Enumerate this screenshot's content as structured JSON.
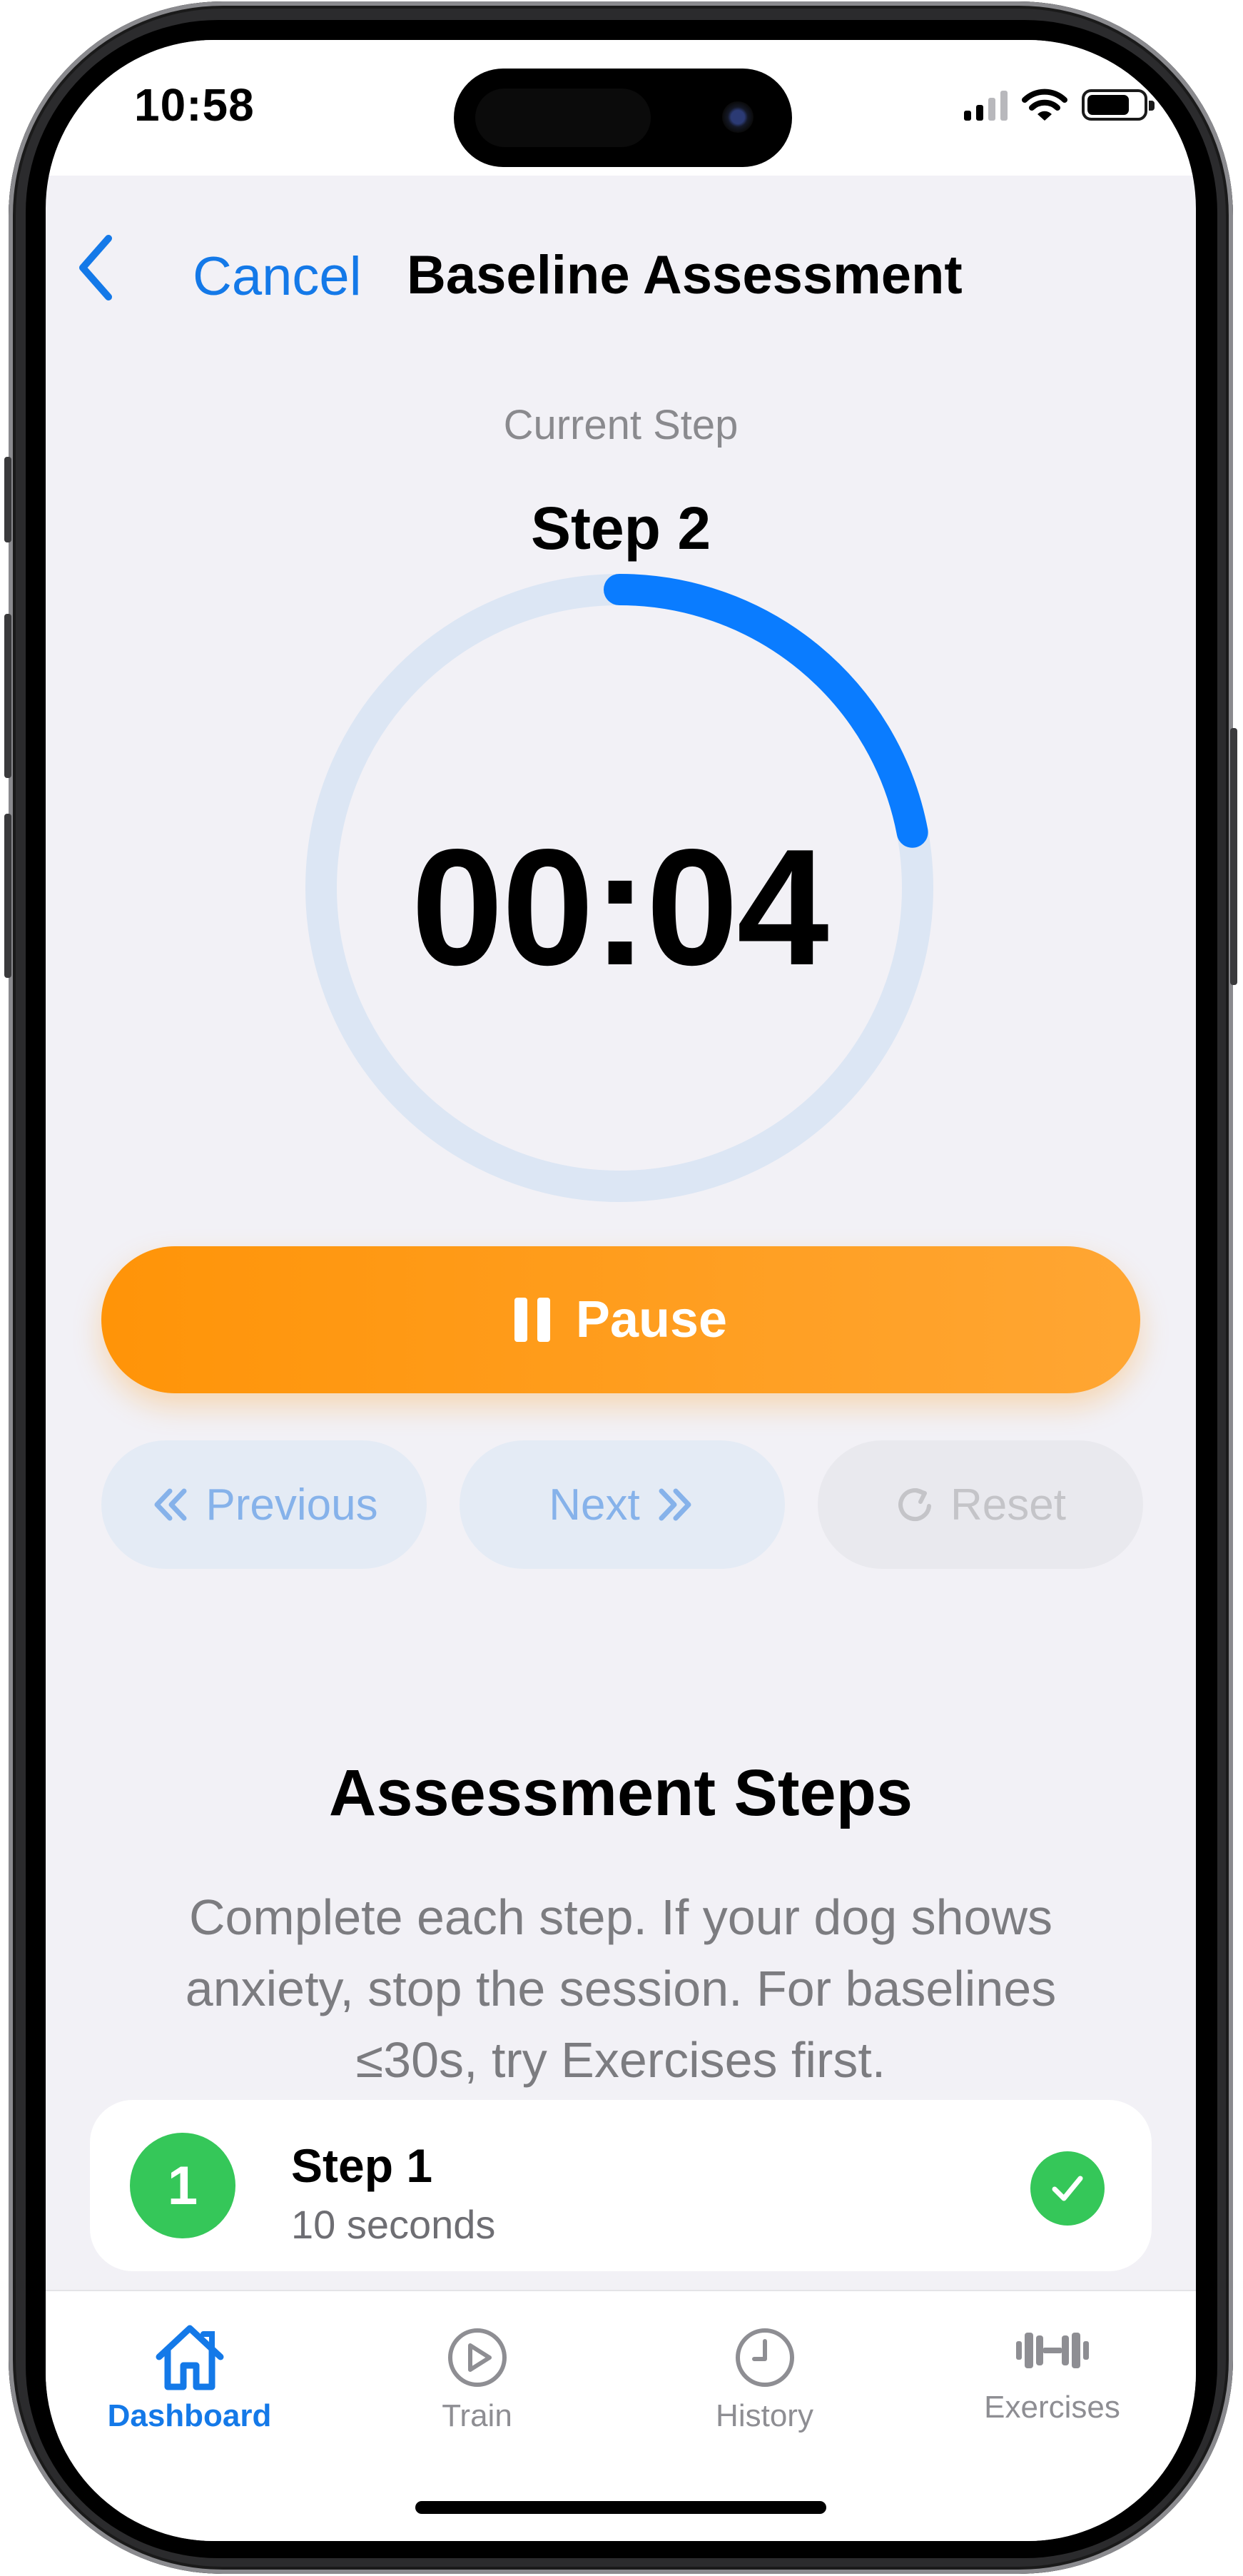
{
  "status_bar": {
    "time": "10:58"
  },
  "nav": {
    "cancel_label": "Cancel",
    "title": "Baseline Assessment"
  },
  "timer": {
    "current_step_label": "Current Step",
    "step_title": "Step 2",
    "display": "00:04",
    "progress_fraction": 0.22
  },
  "controls": {
    "pause_label": "Pause",
    "previous_label": "Previous",
    "next_label": "Next",
    "reset_label": "Reset"
  },
  "assessment": {
    "heading": "Assessment Steps",
    "description": "Complete each step. If your dog shows anxiety, stop the session. For baselines ≤30s, try Exercises first.",
    "steps": [
      {
        "number": "1",
        "name": "Step 1",
        "duration": "10 seconds",
        "completed": true
      }
    ]
  },
  "tab_bar": {
    "items": [
      {
        "label": "Dashboard",
        "icon": "house-icon",
        "active": true
      },
      {
        "label": "Train",
        "icon": "play-circle-icon",
        "active": false
      },
      {
        "label": "History",
        "icon": "clock-icon",
        "active": false
      },
      {
        "label": "Exercises",
        "icon": "dumbbell-icon",
        "active": false
      }
    ]
  },
  "colors": {
    "accent": "#1479e8",
    "pause_button": "#ff9408",
    "success": "#35c759",
    "ring_track": "#dce6f4",
    "background": "#f2f1f6"
  }
}
